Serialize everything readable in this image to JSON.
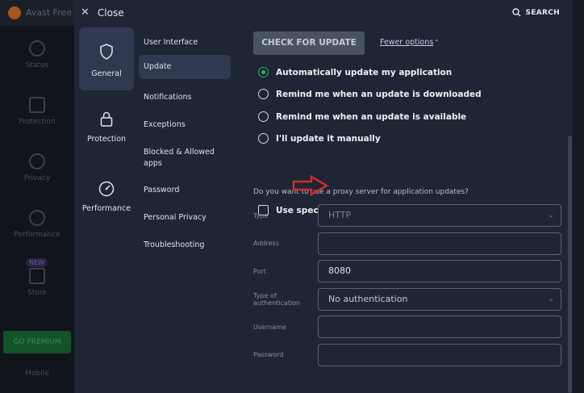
{
  "background_app": {
    "title": "Avast Free A",
    "nav": [
      "Status",
      "Protection",
      "Privacy",
      "Performance",
      "Store",
      "Mobile"
    ],
    "new_badge": "NEW",
    "premium_button": "GO PREMIUM"
  },
  "header": {
    "close_label": "Close",
    "search_label": "SEARCH"
  },
  "categories": [
    {
      "label": "General",
      "icon": "shield-icon"
    },
    {
      "label": "Protection",
      "icon": "lock-icon"
    },
    {
      "label": "Performance",
      "icon": "speedometer-icon"
    }
  ],
  "subnav": [
    "User Interface",
    "Update",
    "Notifications",
    "Exceptions",
    "Blocked & Allowed apps",
    "Password",
    "Personal Privacy",
    "Troubleshooting"
  ],
  "main": {
    "check_button": "CHECK FOR UPDATE",
    "fewer_options": "Fewer options",
    "update_options": [
      "Automatically update my application",
      "Remind me when an update is downloaded",
      "Remind me when an update is available",
      "I'll update it manually"
    ],
    "selected_option": 0,
    "proxy_question": "Do you want to use a proxy server for application updates?",
    "proxy_checkbox_label": "Use specific proxy server",
    "proxy_checked": false,
    "fields": {
      "type": {
        "label": "Type",
        "value": "HTTP"
      },
      "address": {
        "label": "Address",
        "value": ""
      },
      "port": {
        "label": "Port",
        "value": "8080"
      },
      "auth": {
        "label": "Type of authentication",
        "value": "No authentication"
      },
      "username": {
        "label": "Username",
        "value": ""
      },
      "password": {
        "label": "Password",
        "value": ""
      }
    }
  },
  "colors": {
    "panel_bg": "#1e2534",
    "active_bg": "#2f3a50",
    "radio_selected": "#23b56a",
    "annotation_arrow": "#d42a2a"
  }
}
